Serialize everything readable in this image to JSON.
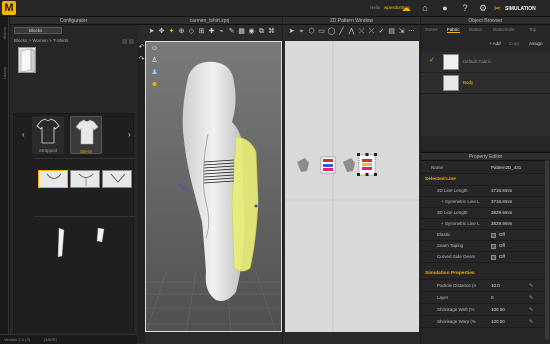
{
  "app": {
    "logo_letter": "M",
    "user_prefix": "Hello",
    "user_name": "wpesdorsteo",
    "mode_label": "SIMULATION"
  },
  "left_strip": {
    "label_a": "History",
    "label_b": "Library"
  },
  "configurator": {
    "title": "Configurator",
    "tab_label": "Blocks",
    "path": "Blocks > Woman > T-Shirts",
    "styles": [
      {
        "label": "Strapped",
        "selected": false
      },
      {
        "label": "Set-In",
        "selected": true
      }
    ],
    "prev_arrow": "‹",
    "next_arrow": "›"
  },
  "window3d": {
    "title": "carmen_tshirt.zprj"
  },
  "window2d": {
    "title": "2D Pattern Window"
  },
  "object_browser": {
    "title": "Object Browser",
    "tabs": [
      "Scene",
      "Fabric",
      "Button",
      "Buttonhole",
      "Top"
    ],
    "active_tab": "Fabric",
    "actions": {
      "add": "+ Add",
      "copy": "Copy",
      "assign": "Assign"
    },
    "fabrics": [
      {
        "name": "Default Fabric",
        "checked": true
      },
      {
        "name": "Body",
        "checked": false
      }
    ]
  },
  "property_editor": {
    "title": "Property Editor",
    "name_label": "Name",
    "name_value": "Pattern2D_431",
    "selected_line_header": "Selected Line",
    "rows": [
      {
        "key": "2D Line Length",
        "val": "3716.8mm"
      },
      {
        "key": "+ Symmetric Line L",
        "val": "3716.8mm"
      },
      {
        "key": "3D Line Length",
        "val": "3829.9mm"
      },
      {
        "key": "+ Symmetric Line L",
        "val": "3829.9mm"
      }
    ],
    "toggles": [
      {
        "key": "Elastic",
        "val": "Off"
      },
      {
        "key": "Seam Taping",
        "val": "Off"
      },
      {
        "key": "Curved Side Geom",
        "val": "Off"
      }
    ],
    "sim_header": "Simulation Properties",
    "sim_rows": [
      {
        "key": "Particle Distance (n",
        "val": "10.0"
      },
      {
        "key": "Layer",
        "val": "0"
      },
      {
        "key": "Shrinkage Weft (%",
        "val": "100.00"
      },
      {
        "key": "Shrinkage Warp (%",
        "val": "100.00"
      }
    ]
  },
  "statusbar": {
    "version": "Version 2.0 (3)",
    "tag": "[3ASR]"
  },
  "colors": {
    "accent": "#f4b400",
    "selection": "#f0ff60",
    "panel": "#262626"
  }
}
